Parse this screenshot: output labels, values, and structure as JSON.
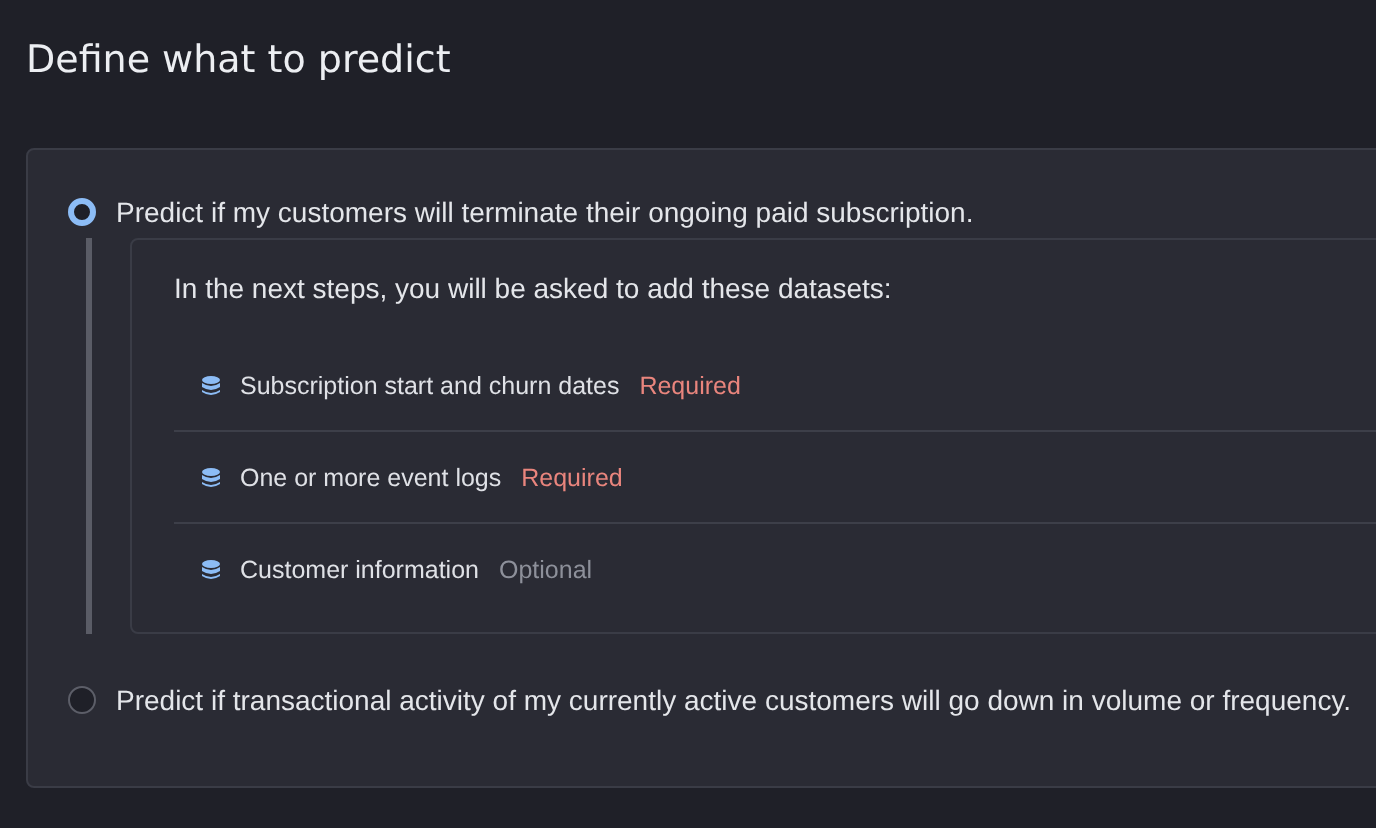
{
  "title": "Define what to predict",
  "options": [
    {
      "label": "Predict if my customers will terminate their ongoing paid subscription.",
      "selected": true,
      "details": {
        "intro": "In the next steps, you will be asked to add these datasets:",
        "datasets": [
          {
            "name": "Subscription start and churn dates",
            "tag": "Required",
            "required": true
          },
          {
            "name": "One or more event logs",
            "tag": "Required",
            "required": true
          },
          {
            "name": "Customer information",
            "tag": "Optional",
            "required": false
          }
        ]
      }
    },
    {
      "label": "Predict if transactional activity of my currently active customers will go down in volume or frequency.",
      "selected": false
    }
  ]
}
